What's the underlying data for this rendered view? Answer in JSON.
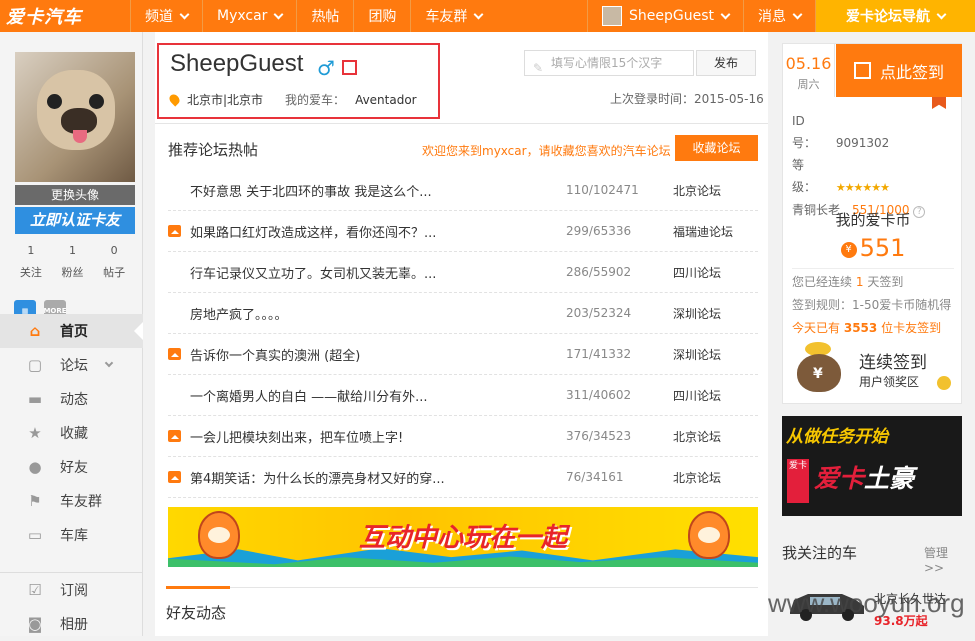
{
  "topbar": {
    "logo": "爱卡汽车",
    "nav": [
      "频道",
      "Myxcar",
      "热帖",
      "团购",
      "车友群"
    ],
    "user": "SheepGuest",
    "messages": "消息",
    "forum_nav": "爱卡论坛导航"
  },
  "colors": {
    "brand": "#ff7a0f",
    "highlight": "#e8333a",
    "link_blue": "#2f8fe0"
  },
  "sidebar": {
    "change_avatar": "更换头像",
    "certify": "立即认证卡友",
    "stats": [
      {
        "value": "1",
        "label": "关注"
      },
      {
        "value": "1",
        "label": "粉丝"
      },
      {
        "value": "0",
        "label": "帖子"
      }
    ],
    "more_badge": "MORE",
    "menu": [
      {
        "label": "首页",
        "icon": "home-icon"
      },
      {
        "label": "论坛",
        "icon": "forum-icon"
      },
      {
        "label": "动态",
        "icon": "chat-icon"
      },
      {
        "label": "收藏",
        "icon": "star-icon"
      },
      {
        "label": "好友",
        "icon": "friends-icon"
      },
      {
        "label": "车友群",
        "icon": "flag-icon"
      },
      {
        "label": "车库",
        "icon": "car-icon"
      }
    ],
    "menu2": [
      {
        "label": "订阅",
        "icon": "subscribe-icon"
      },
      {
        "label": "相册",
        "icon": "camera-icon"
      }
    ]
  },
  "profile": {
    "username": "SheepGuest",
    "gender_symbol": "♂",
    "location": "北京市|北京市",
    "car_label": "我的爱车：",
    "car": "Aventador",
    "mood_placeholder": "填写心情限15个汉字",
    "publish": "发布",
    "last_login": "上次登录时间：2015-05-16"
  },
  "hot_posts": {
    "title": "推荐论坛热帖",
    "welcome": "欢迎您来到myxcar，请收藏您喜欢的汽车论坛",
    "favorite_btn": "收藏论坛",
    "posts": [
      {
        "title": "不好意思 关于北四环的事故 我是这么个...",
        "count": "110/102471",
        "forum": "北京论坛",
        "has_image": false
      },
      {
        "title": "如果路口红灯改造成这样，看你还闯不？...",
        "count": "299/65336",
        "forum": "福瑞迪论坛",
        "has_image": true
      },
      {
        "title": "行车记录仪又立功了。女司机又装无辜。...",
        "count": "286/55902",
        "forum": "四川论坛",
        "has_image": false
      },
      {
        "title": "房地产疯了。。。。",
        "count": "203/52324",
        "forum": "深圳论坛",
        "has_image": false
      },
      {
        "title": "告诉你一个真实的澳洲 (超全)",
        "count": "171/41332",
        "forum": "深圳论坛",
        "has_image": true
      },
      {
        "title": "一个离婚男人的自白 ——献给川分有外...",
        "count": "311/40602",
        "forum": "四川论坛",
        "has_image": false
      },
      {
        "title": "一会儿把模块刻出来，把车位喷上字!",
        "count": "376/34523",
        "forum": "北京论坛",
        "has_image": true
      },
      {
        "title": "第4期笑话：为什么长的漂亮身材又好的穿...",
        "count": "76/34161",
        "forum": "北京论坛",
        "has_image": true
      }
    ],
    "banner_text": "互动中心玩在一起"
  },
  "friends": {
    "title": "好友动态"
  },
  "sign": {
    "date": "05.16",
    "weekday": "周六",
    "button": "点此签到",
    "id_label": "ID　号：",
    "id": "9091302",
    "level_label": "等　级：",
    "level_stars": "★★★★★★",
    "rank_label": "青铜长老",
    "rank_progress": "551/1000",
    "coins_title": "我的爱卡币",
    "coins": "551",
    "streak_line_prefix": "您已经连续",
    "streak_days": "1",
    "streak_line_suffix": "天签到",
    "rule": "签到规则：1-50爱卡币随机得",
    "today_prefix": "今天已有",
    "today_count": "3553",
    "today_suffix": "位卡友签到",
    "streak_title": "连续签到",
    "streak_sub": "用户领奖区"
  },
  "ad": {
    "top": "从做任务开始",
    "big_1": "爱卡",
    "big_2": "土豪",
    "side": "爱卡"
  },
  "follow": {
    "title": "我关注的车",
    "manage": "管理>>",
    "car_name": "北京长久世达",
    "price": "93.8万起"
  },
  "watermark": "www.wooyun.org"
}
